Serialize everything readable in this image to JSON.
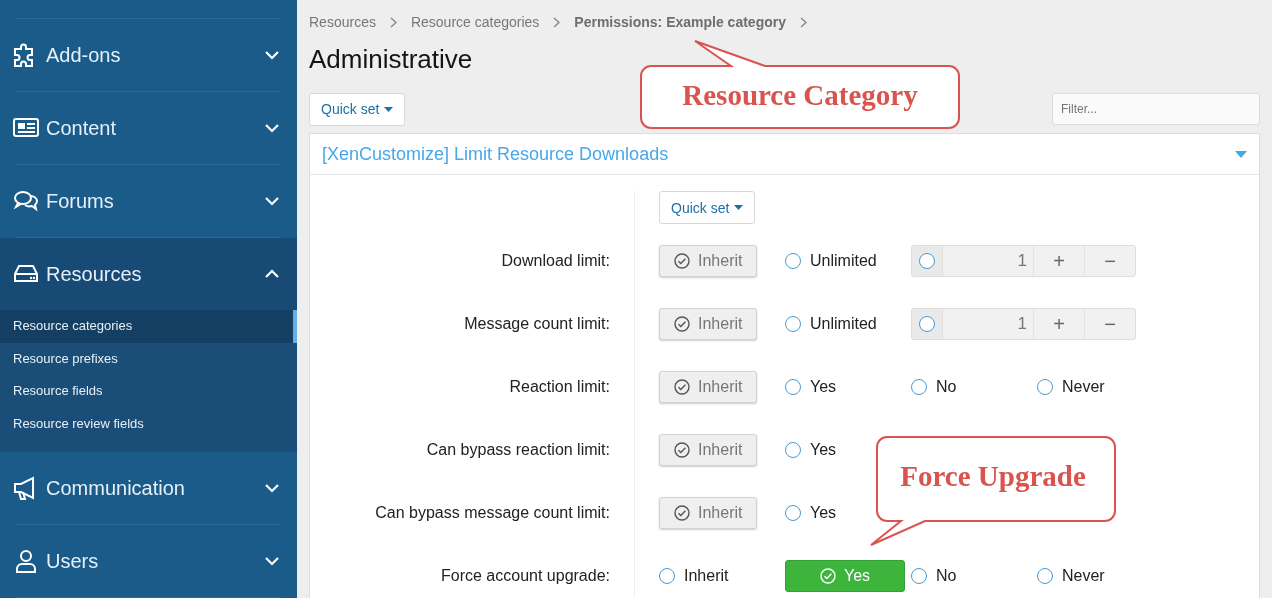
{
  "sidebar": {
    "items": [
      {
        "label": "Add-ons",
        "expanded": false
      },
      {
        "label": "Content",
        "expanded": false
      },
      {
        "label": "Forums",
        "expanded": false
      },
      {
        "label": "Resources",
        "expanded": true,
        "children": [
          {
            "label": "Resource categories",
            "selected": true
          },
          {
            "label": "Resource prefixes",
            "selected": false
          },
          {
            "label": "Resource fields",
            "selected": false
          },
          {
            "label": "Resource review fields",
            "selected": false
          }
        ]
      },
      {
        "label": "Communication",
        "expanded": false
      },
      {
        "label": "Users",
        "expanded": false
      }
    ]
  },
  "breadcrumbs": [
    {
      "label": "Resources",
      "current": false
    },
    {
      "label": "Resource categories",
      "current": false
    },
    {
      "label": "Permissions: Example category",
      "current": true
    }
  ],
  "page_title": "Administrative",
  "quick_set": "Quick set",
  "filter": {
    "placeholder": "Filter..."
  },
  "section": {
    "title": "[XenCustomize] Limit Resource Downloads",
    "expanded": true,
    "quick_set": "Quick set",
    "rows": [
      {
        "label": "Download limit:",
        "options": [
          {
            "label": "Inherit",
            "selected": true
          },
          {
            "label": "Unlimited",
            "selected": false
          }
        ],
        "number": {
          "value": "1",
          "selected": false,
          "plus": "+",
          "minus": "−"
        }
      },
      {
        "label": "Message count limit:",
        "options": [
          {
            "label": "Inherit",
            "selected": true
          },
          {
            "label": "Unlimited",
            "selected": false
          }
        ],
        "number": {
          "value": "1",
          "selected": false,
          "plus": "+",
          "minus": "−"
        }
      },
      {
        "label": "Reaction limit:",
        "options": [
          {
            "label": "Inherit",
            "selected": true
          },
          {
            "label": "Yes",
            "selected": false
          },
          {
            "label": "No",
            "selected": false
          },
          {
            "label": "Never",
            "selected": false
          }
        ]
      },
      {
        "label": "Can bypass reaction limit:",
        "options": [
          {
            "label": "Inherit",
            "selected": true
          },
          {
            "label": "Yes",
            "selected": false
          }
        ]
      },
      {
        "label": "Can bypass message count limit:",
        "options": [
          {
            "label": "Inherit",
            "selected": true
          },
          {
            "label": "Yes",
            "selected": false
          }
        ]
      },
      {
        "label": "Force account upgrade:",
        "options": [
          {
            "label": "Inherit",
            "selected": false
          },
          {
            "label": "Yes",
            "selected": true
          },
          {
            "label": "No",
            "selected": false
          },
          {
            "label": "Never",
            "selected": false
          }
        ]
      }
    ]
  },
  "callouts": [
    {
      "text": "Resource Category"
    },
    {
      "text": "Force Upgrade"
    }
  ]
}
